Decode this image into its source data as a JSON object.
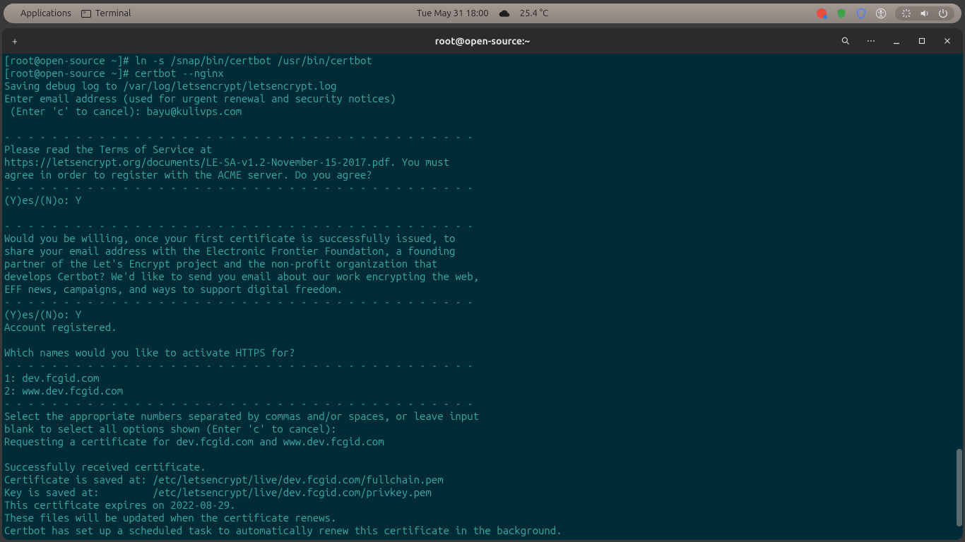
{
  "sysbar": {
    "apple": "",
    "applications": "Applications",
    "terminal": "Terminal",
    "datetime": "Tue May 31  18:00",
    "weather_icon": "cloud-icon",
    "temperature": "25.4 °C"
  },
  "window": {
    "title": "root@open-source:~",
    "newtab": "+"
  },
  "terminal": {
    "lines": [
      "[root@open-source ~]# ln -s /snap/bin/certbot /usr/bin/certbot",
      "[root@open-source ~]# certbot --nginx",
      "Saving debug log to /var/log/letsencrypt/letsencrypt.log",
      "Enter email address (used for urgent renewal and security notices)",
      " (Enter 'c' to cancel): bayu@kulivps.com",
      "",
      "- - - - - - - - - - - - - - - - - - - - - - - - - - - - - - - - - - - - - - - -",
      "Please read the Terms of Service at",
      "https://letsencrypt.org/documents/LE-SA-v1.2-November-15-2017.pdf. You must",
      "agree in order to register with the ACME server. Do you agree?",
      "- - - - - - - - - - - - - - - - - - - - - - - - - - - - - - - - - - - - - - - -",
      "(Y)es/(N)o: Y",
      "",
      "- - - - - - - - - - - - - - - - - - - - - - - - - - - - - - - - - - - - - - - -",
      "Would you be willing, once your first certificate is successfully issued, to",
      "share your email address with the Electronic Frontier Foundation, a founding",
      "partner of the Let's Encrypt project and the non-profit organization that",
      "develops Certbot? We'd like to send you email about our work encrypting the web,",
      "EFF news, campaigns, and ways to support digital freedom.",
      "- - - - - - - - - - - - - - - - - - - - - - - - - - - - - - - - - - - - - - - -",
      "(Y)es/(N)o: Y",
      "Account registered.",
      "",
      "Which names would you like to activate HTTPS for?",
      "- - - - - - - - - - - - - - - - - - - - - - - - - - - - - - - - - - - - - - - -",
      "1: dev.fcgid.com",
      "2: www.dev.fcgid.com",
      "- - - - - - - - - - - - - - - - - - - - - - - - - - - - - - - - - - - - - - - -",
      "Select the appropriate numbers separated by commas and/or spaces, or leave input",
      "blank to select all options shown (Enter 'c' to cancel): ",
      "Requesting a certificate for dev.fcgid.com and www.dev.fcgid.com",
      "",
      "Successfully received certificate.",
      "Certificate is saved at: /etc/letsencrypt/live/dev.fcgid.com/fullchain.pem",
      "Key is saved at:         /etc/letsencrypt/live/dev.fcgid.com/privkey.pem",
      "This certificate expires on 2022-08-29.",
      "These files will be updated when the certificate renews.",
      "Certbot has set up a scheduled task to automatically renew this certificate in the background."
    ]
  }
}
